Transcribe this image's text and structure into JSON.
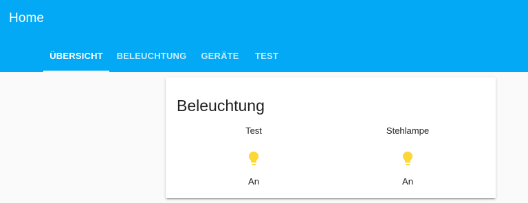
{
  "header": {
    "title": "Home",
    "background_color": "#03a9f4"
  },
  "tabs": [
    {
      "label": "ÜBERSICHT",
      "active": true
    },
    {
      "label": "BELEUCHTUNG",
      "active": false
    },
    {
      "label": "GERÄTE",
      "active": false
    },
    {
      "label": "TEST",
      "active": false
    }
  ],
  "card": {
    "title": "Beleuchtung",
    "entities": [
      {
        "name": "Test",
        "icon": "lightbulb-icon",
        "state": "An",
        "icon_color": "#fdd835"
      },
      {
        "name": "Stehlampe",
        "icon": "lightbulb-icon",
        "state": "An",
        "icon_color": "#fdd835"
      }
    ]
  }
}
